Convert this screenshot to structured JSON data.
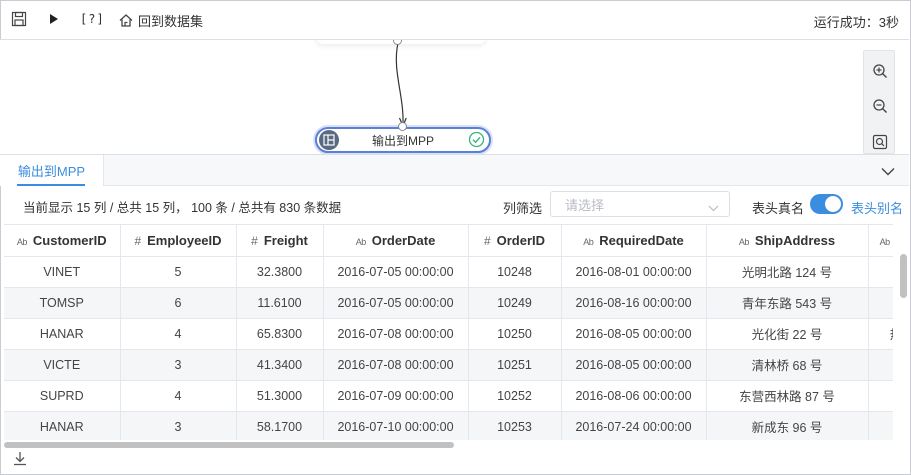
{
  "toolbar": {
    "help_label": "[?]",
    "back_label": "回到数据集",
    "run_status": "运行成功：3秒"
  },
  "canvas": {
    "node_label": "输出到MPP"
  },
  "panel": {
    "tab_label": "输出到MPP",
    "summary": "当前显示 15 列 / 总共 15 列， 100 条 / 总共有 830 条数据",
    "filter_label": "列筛选",
    "filter_placeholder": "请选择",
    "real_name_label": "表头真名",
    "alias_label": "表头别名",
    "toggle_on": true
  },
  "table": {
    "columns": [
      {
        "type": "Ab",
        "name": "CustomerID"
      },
      {
        "type": "#",
        "name": "EmployeeID"
      },
      {
        "type": "#",
        "name": "Freight"
      },
      {
        "type": "Ab",
        "name": "OrderDate"
      },
      {
        "type": "#",
        "name": "OrderID"
      },
      {
        "type": "Ab",
        "name": "RequiredDate"
      },
      {
        "type": "Ab",
        "name": "ShipAddress"
      },
      {
        "type": "Ab",
        "name": "Sh"
      }
    ],
    "rows": [
      [
        "VINET",
        "5",
        "32.3800",
        "2016-07-05 00:00:00",
        "10248",
        "2016-08-01 00:00:00",
        "光明北路 124 号",
        ""
      ],
      [
        "TOMSP",
        "6",
        "11.6100",
        "2016-07-05 00:00:00",
        "10249",
        "2016-08-16 00:00:00",
        "青年东路 543 号",
        ""
      ],
      [
        "HANAR",
        "4",
        "65.8300",
        "2016-07-08 00:00:00",
        "10250",
        "2016-08-05 00:00:00",
        "光化街 22 号",
        "热"
      ],
      [
        "VICTE",
        "3",
        "41.3400",
        "2016-07-08 00:00:00",
        "10251",
        "2016-08-05 00:00:00",
        "清林桥 68 号",
        ""
      ],
      [
        "SUPRD",
        "4",
        "51.3000",
        "2016-07-09 00:00:00",
        "10252",
        "2016-08-06 00:00:00",
        "东营西林路 87 号",
        ""
      ],
      [
        "HANAR",
        "3",
        "58.1700",
        "2016-07-10 00:00:00",
        "10253",
        "2016-07-24 00:00:00",
        "新成东 96 号",
        ""
      ]
    ]
  },
  "icons": {
    "save": "save-icon",
    "run": "play-icon",
    "back": "home-back-icon",
    "zoom_in": "zoom-in-icon",
    "zoom_out": "zoom-out-icon",
    "fit": "fit-view-icon",
    "collapse": "chevron-down-icon",
    "download": "download-icon",
    "node_ok": "check-circle-icon"
  },
  "colors": {
    "accent": "#3b8de0",
    "node_border": "#5b7fd6",
    "success": "#36b37e"
  }
}
